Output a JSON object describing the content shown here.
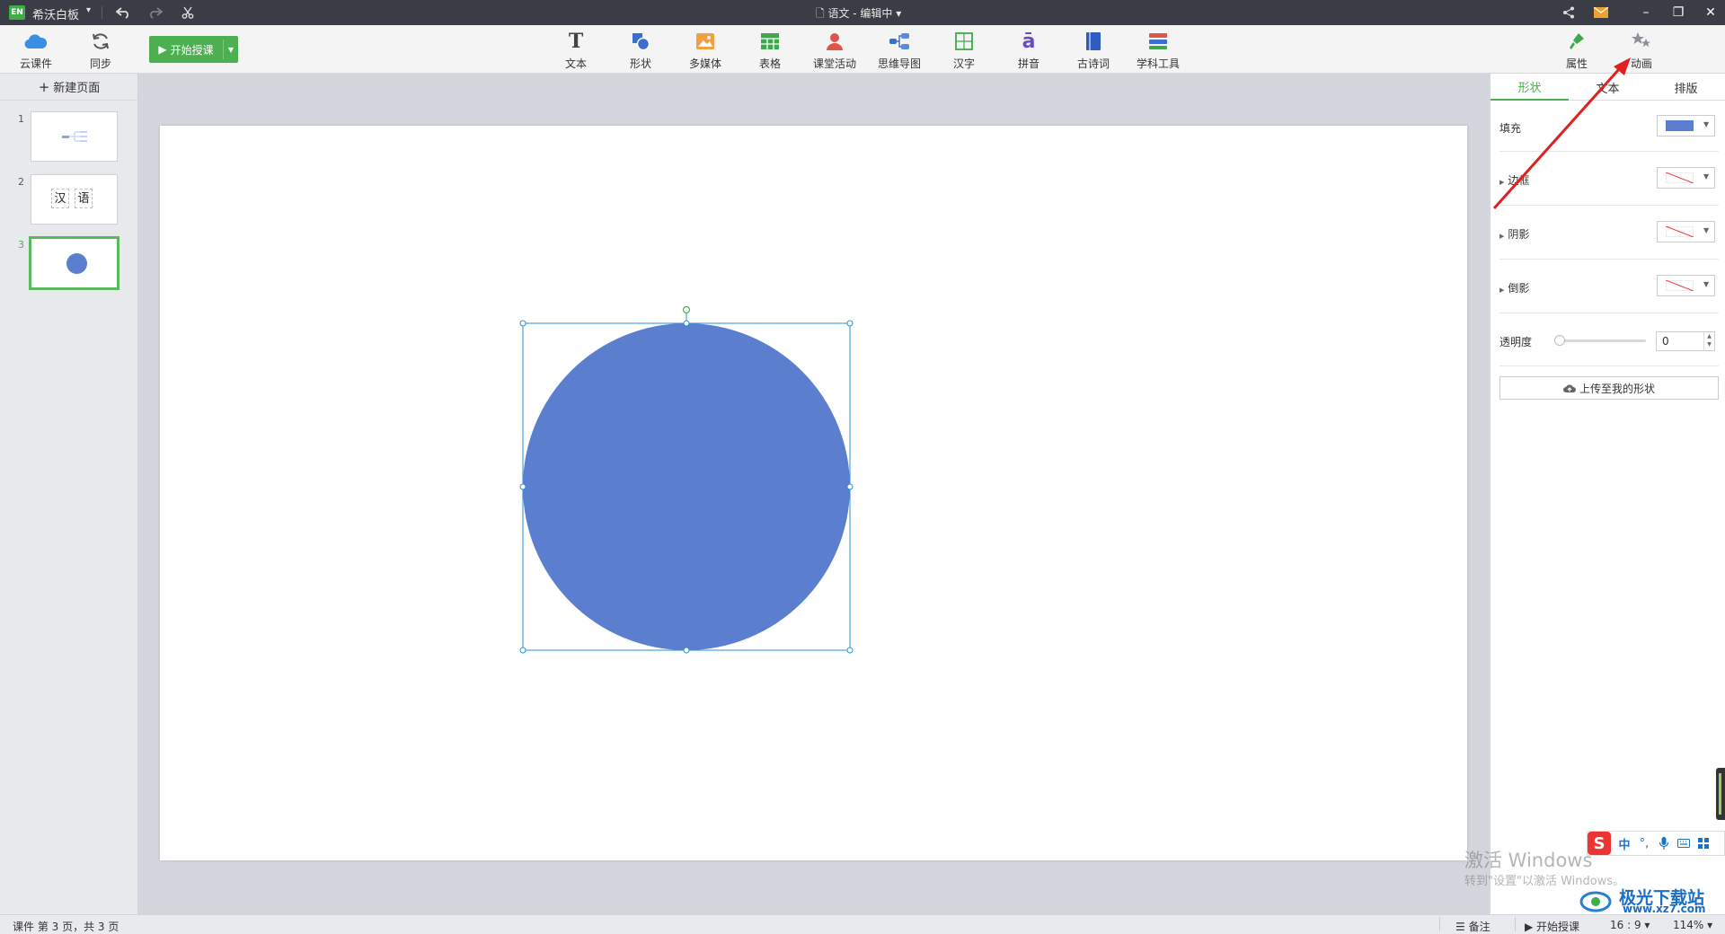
{
  "titlebar": {
    "logo": "EN",
    "app_name": "希沃白板",
    "doc_title": "语文 - 编辑中"
  },
  "toolbar": {
    "left": [
      {
        "label": "云课件",
        "icon": "cloud-icon"
      },
      {
        "label": "同步",
        "icon": "sync-icon"
      }
    ],
    "start_label": "开始授课",
    "tools": [
      {
        "label": "文本",
        "icon": "text-icon"
      },
      {
        "label": "形状",
        "icon": "shape-icon"
      },
      {
        "label": "多媒体",
        "icon": "media-icon"
      },
      {
        "label": "表格",
        "icon": "table-icon"
      },
      {
        "label": "课堂活动",
        "icon": "class-activity-icon"
      },
      {
        "label": "思维导图",
        "icon": "mindmap-icon"
      },
      {
        "label": "汉字",
        "icon": "hanzi-icon"
      },
      {
        "label": "拼音",
        "icon": "pinyin-icon"
      },
      {
        "label": "古诗词",
        "icon": "poetry-icon"
      },
      {
        "label": "学科工具",
        "icon": "subject-tools-icon"
      }
    ],
    "right": [
      {
        "label": "属性",
        "icon": "brush-icon"
      },
      {
        "label": "动画",
        "icon": "stars-icon"
      }
    ]
  },
  "left_panel": {
    "new_page_label": "新建页面",
    "thumbnails": [
      {
        "number": "1"
      },
      {
        "number": "2",
        "chars": [
          "汉",
          "语"
        ]
      },
      {
        "number": "3"
      }
    ]
  },
  "right_panel": {
    "tabs": [
      "形状",
      "文本",
      "排版"
    ],
    "active_tab": "形状",
    "fill_label": "填充",
    "fill_color": "#5b7fce",
    "border_label": "边框",
    "shadow_label": "阴影",
    "reflection_label": "倒影",
    "opacity_label": "透明度",
    "opacity_value": "0",
    "upload_label": "上传至我的形状"
  },
  "canvas": {
    "shape_color": "#5b7fce",
    "selection_color": "#2b8fd6"
  },
  "statusbar": {
    "page_info": "课件 第 3 页，共 3 页",
    "notes_label": "备注",
    "start_label": "开始授课",
    "ratio": "16 : 9",
    "zoom": "114%"
  },
  "watermark": {
    "activate_title": "激活 Windows",
    "activate_sub": "转到\"设置\"以激活 Windows。",
    "site_name": "极光下载站",
    "site_url": "www.xz7.com"
  },
  "ime": {
    "items": [
      "中",
      "°,"
    ]
  },
  "colors": {
    "accent_green": "#4caf50",
    "annotation_arrow": "#e02020"
  }
}
